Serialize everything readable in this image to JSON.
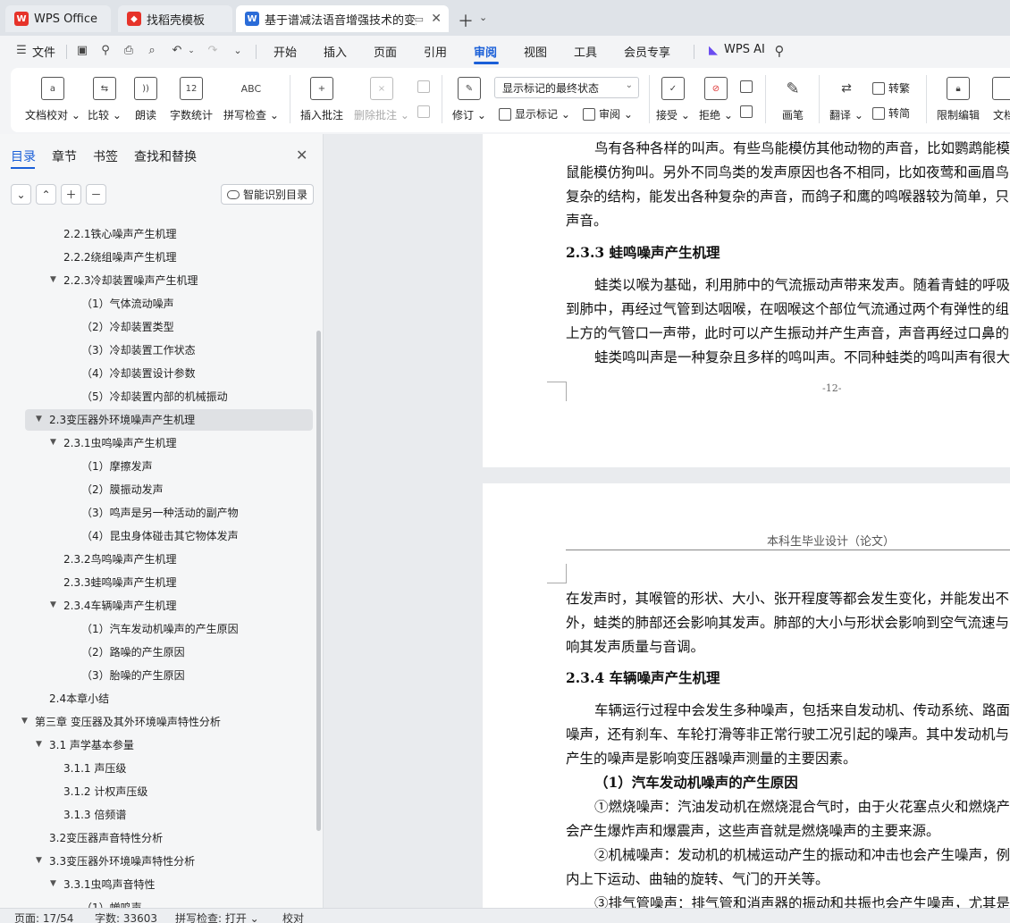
{
  "tabs": [
    {
      "label": "WPS Office",
      "icon": "wps-logo-icon",
      "color": "#e6332a"
    },
    {
      "label": "找稻壳模板",
      "icon": "docer-logo-icon",
      "color": "#e6332a"
    },
    {
      "label": "基于谱减法语音增强技术的变压",
      "icon": "word-doc-icon",
      "color": "#2b6cd8",
      "close": "✕"
    }
  ],
  "menu": {
    "file": "文件",
    "items": [
      "开始",
      "插入",
      "页面",
      "引用",
      "审阅",
      "视图",
      "工具",
      "会员专享"
    ],
    "active": "审阅",
    "wps_ai": "WPS AI"
  },
  "ribbon": {
    "doc_check": "文档校对",
    "compare": "比较",
    "read_aloud": "朗读",
    "word_count": "字数统计",
    "spell_check": "拼写检查",
    "insert_comment": "插入批注",
    "delete_comment": "删除批注",
    "revise": "修订",
    "markup_mode": "显示标记的最终状态",
    "show_markup": "显示标记",
    "review": "审阅",
    "accept": "接受",
    "reject": "拒绝",
    "ink": "画笔",
    "translate": "翻译",
    "to_traditional": "转繁",
    "to_simplified": "转简",
    "restrict_edit": "限制编辑",
    "doc_partial": "文档",
    "icon_abc": "ABC",
    "icon_12": "12"
  },
  "sidebar": {
    "tabs": [
      "目录",
      "章节",
      "书签",
      "查找和替换"
    ],
    "smart_toc": "智能识别目录",
    "toc": [
      {
        "text": "2.2.1铁心噪声产生机理",
        "level": 3,
        "caret": ""
      },
      {
        "text": "2.2.2绕组噪声产生机理",
        "level": 3,
        "caret": ""
      },
      {
        "text": "2.2.3冷却装置噪声产生机理",
        "level": 3,
        "caret": "▼"
      },
      {
        "text": "（1）气体流动噪声",
        "level": 4,
        "caret": ""
      },
      {
        "text": "（2）冷却装置类型",
        "level": 4,
        "caret": ""
      },
      {
        "text": "（3）冷却装置工作状态",
        "level": 4,
        "caret": ""
      },
      {
        "text": "（4）冷却装置设计参数",
        "level": 4,
        "caret": ""
      },
      {
        "text": "（5）冷却装置内部的机械振动",
        "level": 4,
        "caret": ""
      },
      {
        "text": "2.3变压器外环境噪声产生机理",
        "level": 2,
        "caret": "▼",
        "selected": true
      },
      {
        "text": "2.3.1虫鸣噪声产生机理",
        "level": 3,
        "caret": "▼"
      },
      {
        "text": "（1）摩擦发声",
        "level": 4,
        "caret": ""
      },
      {
        "text": "（2）膜振动发声",
        "level": 4,
        "caret": ""
      },
      {
        "text": "（3）鸣声是另一种活动的副产物",
        "level": 4,
        "caret": ""
      },
      {
        "text": "（4）昆虫身体碰击其它物体发声",
        "level": 4,
        "caret": ""
      },
      {
        "text": "2.3.2鸟鸣噪声产生机理",
        "level": 3,
        "caret": ""
      },
      {
        "text": "2.3.3蛙鸣噪声产生机理",
        "level": 3,
        "caret": ""
      },
      {
        "text": "2.3.4车辆噪声产生机理",
        "level": 3,
        "caret": "▼"
      },
      {
        "text": "（1）汽车发动机噪声的产生原因",
        "level": 4,
        "caret": ""
      },
      {
        "text": "（2）路噪的产生原因",
        "level": 4,
        "caret": ""
      },
      {
        "text": "（3）胎噪的产生原因",
        "level": 4,
        "caret": ""
      },
      {
        "text": "2.4本章小结",
        "level": 2,
        "caret": ""
      },
      {
        "text": "第三章  变压器及其外环境噪声特性分析",
        "level": 1,
        "caret": "▼"
      },
      {
        "text": "3.1  声学基本参量",
        "level": 2,
        "caret": "▼"
      },
      {
        "text": "3.1.1  声压级",
        "level": 3,
        "caret": ""
      },
      {
        "text": "3.1.2  计权声压级",
        "level": 3,
        "caret": ""
      },
      {
        "text": "3.1.3  倍频谱",
        "level": 3,
        "caret": ""
      },
      {
        "text": "3.2变压器声音特性分析",
        "level": 2,
        "caret": ""
      },
      {
        "text": "3.3变压器外环境噪声特性分析",
        "level": 2,
        "caret": "▼"
      },
      {
        "text": "3.3.1虫鸣声音特性",
        "level": 3,
        "caret": "▼"
      },
      {
        "text": "（1）蝉鸣声",
        "level": 4,
        "caret": ""
      }
    ]
  },
  "page1": {
    "lines": [
      "鸟有各种各样的叫声。有些鸟能模仿其他动物的声音，比如鹦鹉能模",
      "鼠能模仿狗叫。另外不同鸟类的发声原因也各不相同，比如夜莺和画眉鸟",
      "复杂的结构，能发出各种复杂的声音，而鸽子和鹰的鸣喉器较为简单，只",
      "声音。"
    ],
    "heading": "2.3.3 蛙鸣噪声产生机理",
    "lines2": [
      "蛙类以喉为基础，利用肺中的气流振动声带来发声。随着青蛙的呼吸",
      "到肺中，再经过气管到达咽喉，在咽喉这个部位气流通过两个有弹性的组",
      "上方的气管口一声带，此时可以产生振动并产生声音，声音再经过口鼻的",
      "蛙类鸣叫声是一种复杂且多样的鸣叫声。不同种蛙类的鸣叫声有很大"
    ],
    "page_number": "-12-"
  },
  "page2": {
    "header": "本科生毕业设计（论文）",
    "lines": [
      "在发声时，其喉管的形状、大小、张开程度等都会发生变化，并能发出不",
      "外，蛙类的肺部还会影响其发声。肺部的大小与形状会影响到空气流速与",
      "响其发声质量与音调。"
    ],
    "heading": "2.3.4 车辆噪声产生机理",
    "lines2": [
      "车辆运行过程中会发生多种噪声，包括来自发动机、传动系统、路面",
      "噪声，还有刹车、车轮打滑等非正常行驶工况引起的噪声。其中发动机与",
      "产生的噪声是影响变压器噪声测量的主要因素。"
    ],
    "subheading": "（1）汽车发动机噪声的产生原因",
    "lines3": [
      "①燃烧噪声：汽油发动机在燃烧混合气时，由于火花塞点火和燃烧产",
      "会产生爆炸声和爆震声，这些声音就是燃烧噪声的主要来源。",
      "②机械噪声：发动机的机械运动产生的振动和冲击也会产生噪声，例",
      "内上下运动、曲轴的旋转、气门的开关等。",
      "③排气管噪声：排气管和消声器的振动和共振也会产生噪声，尤其是"
    ]
  },
  "status": {
    "page": "页面: 17/54",
    "words": "字数: 33603",
    "spell": "拼写检查: 打开",
    "proof": "校对"
  }
}
